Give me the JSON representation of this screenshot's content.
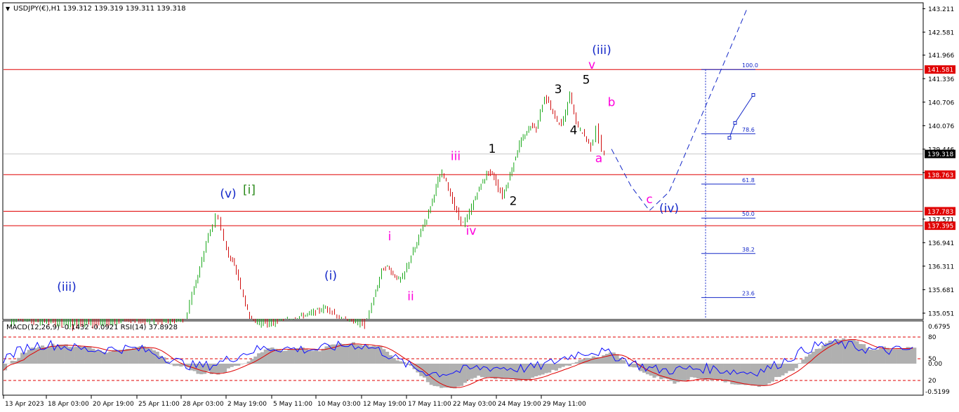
{
  "header": {
    "arrow": "▼",
    "title": "USDJPY(€),H1  139.312 139.319 139.311 139.318"
  },
  "indicator": {
    "label": "MACD(12,26,9) -0.1432 -0.0921  RSI(14) 37.8928",
    "macd_axis": [
      "0.6795",
      "0.00",
      "-0.5199"
    ],
    "rsi_axis": [
      "80",
      "50",
      "20"
    ]
  },
  "colors": {
    "background": "#ffffff",
    "resistance_line": "#e00000",
    "price_badge_bg": "#e00000",
    "current_price_bg": "#000000",
    "bull_candle": "#1aa81a",
    "bear_candle": "#d01010",
    "wave_blue": "#1428c8",
    "wave_magenta": "#ff00dc",
    "wave_black": "#000000",
    "wave_green": "#2a8a1a",
    "macd_hist": "#b0b0b0",
    "macd_signal": "#e00000",
    "rsi_line": "#1010ff"
  },
  "chart_data": {
    "type": "line",
    "symbol": "USDJPY(€)",
    "timeframe": "H1",
    "ohlc_last": {
      "open": 139.312,
      "high": 139.319,
      "low": 139.311,
      "close": 139.318
    },
    "ylim": [
      134.9,
      143.35
    ],
    "yticks": [
      "143.211",
      "142.581",
      "141.966",
      "141.336",
      "140.706",
      "140.076",
      "139.446",
      "138.816",
      "137.571",
      "136.941",
      "136.311",
      "135.681",
      "135.051"
    ],
    "xticks": [
      "13 Apr 2023",
      "18 Apr 03:00",
      "20 Apr 19:00",
      "25 Apr 11:00",
      "28 Apr 03:00",
      "2 May 19:00",
      "5 May 11:00",
      "10 May 03:00",
      "12 May 19:00",
      "17 May 11:00",
      "22 May 03:00",
      "24 May 19:00",
      "29 May 11:00"
    ],
    "current_price": "139.318",
    "horizontal_levels": [
      {
        "label": "141.581",
        "value": 141.581
      },
      {
        "label": "138.763",
        "value": 138.763
      },
      {
        "label": "137.783",
        "value": 137.783
      },
      {
        "label": "137.395",
        "value": 137.395
      }
    ],
    "fib_levels": [
      {
        "label": "100.0",
        "value": 141.581
      },
      {
        "label": "78.6",
        "value": 139.86
      },
      {
        "label": "61.8",
        "value": 138.51
      },
      {
        "label": "50.0",
        "value": 137.6
      },
      {
        "label": "38.2",
        "value": 136.65
      },
      {
        "label": "23.6",
        "value": 135.47
      }
    ],
    "price_path": [
      {
        "x": 0.5,
        "y": 134.6
      },
      {
        "x": 1,
        "y": 134.8
      },
      {
        "x": 3,
        "y": 134.7
      },
      {
        "x": 5,
        "y": 134.6
      },
      {
        "x": 6,
        "y": 134.7
      },
      {
        "x": 7,
        "y": 134.6
      },
      {
        "x": 8,
        "y": 134.7
      },
      {
        "x": 9,
        "y": 134.8
      },
      {
        "x": 10,
        "y": 134.7
      },
      {
        "x": 10.5,
        "y": 134.75
      },
      {
        "x": 11.5,
        "y": 134.7
      },
      {
        "x": 13.0,
        "y": 134.8
      },
      {
        "x": 13.5,
        "y": 135.6
      },
      {
        "x": 13.9,
        "y": 136.1
      },
      {
        "x": 14.2,
        "y": 136.5
      },
      {
        "x": 14.5,
        "y": 137.0
      },
      {
        "x": 14.8,
        "y": 137.25
      },
      {
        "x": 15.0,
        "y": 137.4
      },
      {
        "x": 15.2,
        "y": 137.7
      },
      {
        "x": 15.4,
        "y": 137.58
      },
      {
        "x": 15.6,
        "y": 137.3
      },
      {
        "x": 15.8,
        "y": 137.0
      },
      {
        "x": 16.1,
        "y": 136.6
      },
      {
        "x": 16.5,
        "y": 136.3
      },
      {
        "x": 16.8,
        "y": 136.0
      },
      {
        "x": 17.0,
        "y": 135.7
      },
      {
        "x": 17.3,
        "y": 135.3
      },
      {
        "x": 17.6,
        "y": 134.9
      },
      {
        "x": 18,
        "y": 134.7
      },
      {
        "x": 19,
        "y": 134.6
      },
      {
        "x": 20,
        "y": 134.8
      },
      {
        "x": 21,
        "y": 134.95
      },
      {
        "x": 22,
        "y": 135.05
      },
      {
        "x": 23,
        "y": 135.2
      },
      {
        "x": 23.5,
        "y": 135.1
      },
      {
        "x": 24.0,
        "y": 134.9
      },
      {
        "x": 25,
        "y": 134.7
      },
      {
        "x": 25.8,
        "y": 134.6
      },
      {
        "x": 26.3,
        "y": 135.3
      },
      {
        "x": 26.7,
        "y": 135.8
      },
      {
        "x": 27.0,
        "y": 136.2
      },
      {
        "x": 27.4,
        "y": 136.3
      },
      {
        "x": 27.8,
        "y": 136.1
      },
      {
        "x": 28.2,
        "y": 135.95
      },
      {
        "x": 28.5,
        "y": 136.0
      },
      {
        "x": 28.8,
        "y": 136.3
      },
      {
        "x": 29.1,
        "y": 136.6
      },
      {
        "x": 29.5,
        "y": 136.9
      },
      {
        "x": 29.8,
        "y": 137.3
      },
      {
        "x": 30.2,
        "y": 137.6
      },
      {
        "x": 30.6,
        "y": 138.1
      },
      {
        "x": 31.0,
        "y": 138.6
      },
      {
        "x": 31.3,
        "y": 138.8
      },
      {
        "x": 31.6,
        "y": 138.6
      },
      {
        "x": 31.9,
        "y": 138.2
      },
      {
        "x": 32.2,
        "y": 137.9
      },
      {
        "x": 32.5,
        "y": 137.6
      },
      {
        "x": 32.8,
        "y": 137.45
      },
      {
        "x": 33.1,
        "y": 137.6
      },
      {
        "x": 33.4,
        "y": 137.9
      },
      {
        "x": 33.8,
        "y": 138.3
      },
      {
        "x": 34.2,
        "y": 138.6
      },
      {
        "x": 34.6,
        "y": 138.85
      },
      {
        "x": 35.0,
        "y": 138.7
      },
      {
        "x": 35.3,
        "y": 138.4
      },
      {
        "x": 35.6,
        "y": 138.2
      },
      {
        "x": 36.0,
        "y": 138.6
      },
      {
        "x": 36.4,
        "y": 139.1
      },
      {
        "x": 36.8,
        "y": 139.6
      },
      {
        "x": 37.2,
        "y": 139.8
      },
      {
        "x": 37.6,
        "y": 140.1
      },
      {
        "x": 38.0,
        "y": 140.0
      },
      {
        "x": 38.3,
        "y": 140.5
      },
      {
        "x": 38.6,
        "y": 140.8
      },
      {
        "x": 38.9,
        "y": 140.7
      },
      {
        "x": 39.2,
        "y": 140.4
      },
      {
        "x": 39.5,
        "y": 140.2
      },
      {
        "x": 39.8,
        "y": 140.1
      },
      {
        "x": 40.1,
        "y": 140.4
      },
      {
        "x": 40.4,
        "y": 140.95
      },
      {
        "x": 40.7,
        "y": 140.4
      },
      {
        "x": 41.0,
        "y": 140.0
      },
      {
        "x": 41.3,
        "y": 139.9
      },
      {
        "x": 41.6,
        "y": 139.7
      },
      {
        "x": 41.9,
        "y": 139.5
      },
      {
        "x": 42.1,
        "y": 139.7
      },
      {
        "x": 42.3,
        "y": 140.1
      },
      {
        "x": 42.5,
        "y": 139.7
      },
      {
        "x": 42.7,
        "y": 139.4
      },
      {
        "x": 42.9,
        "y": 139.3
      }
    ],
    "projection": [
      {
        "x": 43.3,
        "y": 139.45
      },
      {
        "x": 44.7,
        "y": 138.45
      },
      {
        "x": 46.0,
        "y": 137.8
      },
      {
        "x": 47.4,
        "y": 138.3
      },
      {
        "x": 53.0,
        "y": 143.25
      }
    ],
    "small_projection": [
      {
        "x": 51.7,
        "y": 139.75
      },
      {
        "x": 52.1,
        "y": 140.15
      },
      {
        "x": 53.4,
        "y": 140.9
      }
    ],
    "fib_anchor_x": 49.7,
    "wave_labels": [
      {
        "text": "(iii)",
        "x": 4.5,
        "y": 135.65,
        "color": "blue"
      },
      {
        "text": "(v)",
        "x": 16.0,
        "y": 138.15,
        "color": "blue"
      },
      {
        "text": "[i]",
        "x": 17.5,
        "y": 138.25,
        "color": "green"
      },
      {
        "text": "(i)",
        "x": 23.3,
        "y": 135.95,
        "color": "blue"
      },
      {
        "text": "i",
        "x": 27.5,
        "y": 137.0,
        "color": "magenta"
      },
      {
        "text": "ii",
        "x": 29.0,
        "y": 135.4,
        "color": "magenta"
      },
      {
        "text": "iii",
        "x": 32.2,
        "y": 139.15,
        "color": "magenta"
      },
      {
        "text": "iv",
        "x": 33.3,
        "y": 137.15,
        "color": "magenta"
      },
      {
        "text": "1",
        "x": 34.8,
        "y": 139.35,
        "color": "black"
      },
      {
        "text": "2",
        "x": 36.3,
        "y": 137.95,
        "color": "black"
      },
      {
        "text": "3",
        "x": 39.5,
        "y": 140.95,
        "color": "black"
      },
      {
        "text": "4",
        "x": 40.6,
        "y": 139.85,
        "color": "black"
      },
      {
        "text": "5",
        "x": 41.5,
        "y": 141.2,
        "color": "black"
      },
      {
        "text": "v",
        "x": 41.9,
        "y": 141.6,
        "color": "magenta"
      },
      {
        "text": "(iii)",
        "x": 42.6,
        "y": 142.0,
        "color": "blue"
      },
      {
        "text": "b",
        "x": 43.3,
        "y": 140.6,
        "color": "magenta"
      },
      {
        "text": "a",
        "x": 42.4,
        "y": 139.1,
        "color": "magenta"
      },
      {
        "text": "c",
        "x": 46.0,
        "y": 138.0,
        "color": "magenta"
      },
      {
        "text": "(iv)",
        "x": 47.4,
        "y": 137.75,
        "color": "blue"
      }
    ]
  }
}
